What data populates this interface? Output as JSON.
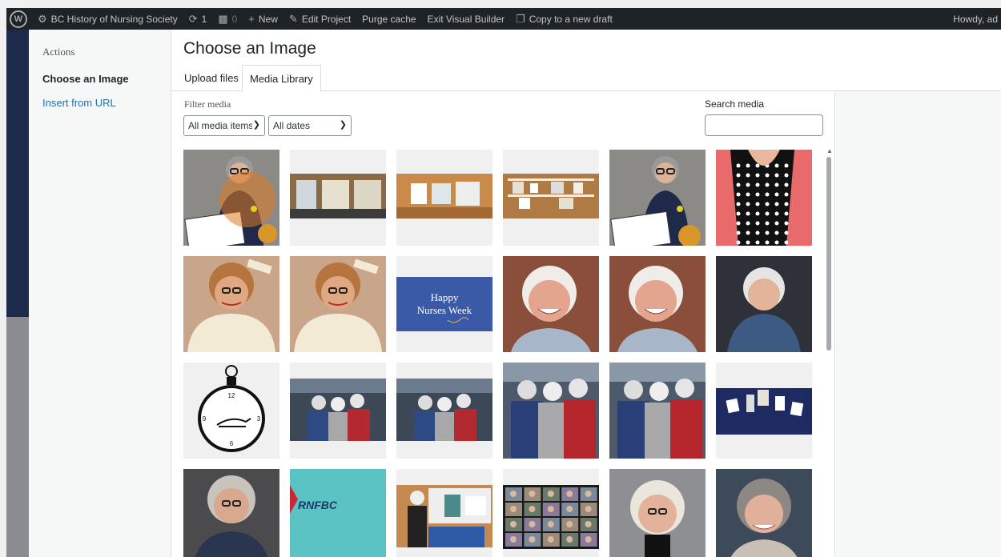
{
  "admin_bar": {
    "site_name": "BC History of Nursing Society",
    "updates_count": "1",
    "comments_count": "0",
    "new_label": "New",
    "edit_project_label": "Edit Project",
    "purge_cache_label": "Purge cache",
    "exit_builder_label": "Exit Visual Builder",
    "copy_draft_label": "Copy to a new draft",
    "howdy_label": "Howdy, ad"
  },
  "menu": {
    "heading": "Actions",
    "items": [
      {
        "label": "Choose an Image",
        "active": true
      },
      {
        "label": "Insert from URL",
        "active": false
      }
    ]
  },
  "modal": {
    "title": "Choose an Image",
    "tabs": [
      {
        "label": "Upload files",
        "active": false
      },
      {
        "label": "Media Library",
        "active": true
      }
    ]
  },
  "toolbar": {
    "filter_label": "Filter media",
    "type_filter_value": "All media items",
    "date_filter_value": "All dates",
    "search_label": "Search media",
    "search_value": ""
  },
  "media_items": [
    {
      "kind": "award-portrait-selected"
    },
    {
      "kind": "display-case-wide"
    },
    {
      "kind": "display-case-orange"
    },
    {
      "kind": "display-case-shelves"
    },
    {
      "kind": "award-portrait"
    },
    {
      "kind": "polka-dot-woman"
    },
    {
      "kind": "vintage-nurse-portrait"
    },
    {
      "kind": "vintage-nurse-portrait"
    },
    {
      "kind": "happy-nurses-week-card",
      "text_line1": "Happy",
      "text_line2": "Nurses Week"
    },
    {
      "kind": "smiling-woman"
    },
    {
      "kind": "smiling-woman"
    },
    {
      "kind": "woman-portrait-gray"
    },
    {
      "kind": "pocket-watch-lamp-logo"
    },
    {
      "kind": "group-of-three-wide"
    },
    {
      "kind": "group-of-three-wide"
    },
    {
      "kind": "group-of-three"
    },
    {
      "kind": "group-of-three"
    },
    {
      "kind": "artifact-display-blue"
    },
    {
      "kind": "older-woman-portrait"
    },
    {
      "kind": "rnfbc-banner",
      "text": "RNFBC"
    },
    {
      "kind": "exhibit-booth"
    },
    {
      "kind": "video-call-grid"
    },
    {
      "kind": "white-hair-woman"
    },
    {
      "kind": "gray-hair-woman"
    }
  ],
  "colors": {
    "admin_bar_bg": "#1d2327",
    "link_blue": "#2271b1",
    "selection_orange": "#e07b24",
    "nurses_week_blue": "#3a5aa8",
    "rnfbc_teal": "#5cc3c4",
    "rnfbc_red": "#c8293a"
  }
}
